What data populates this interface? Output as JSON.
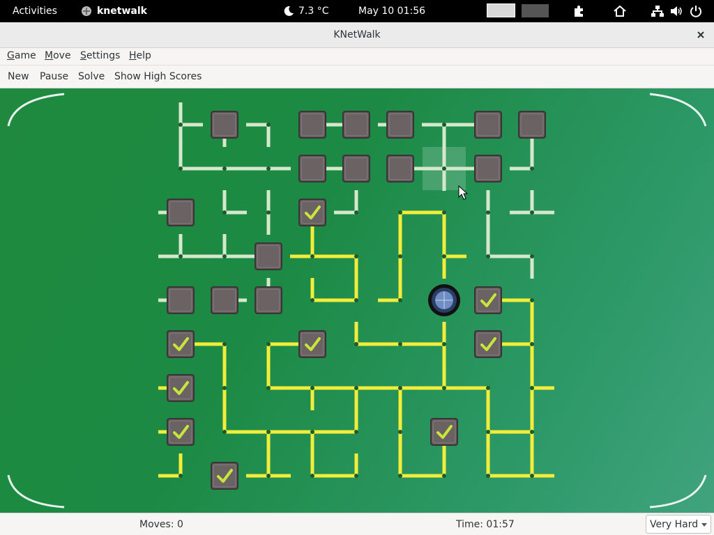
{
  "topbar": {
    "activities": "Activities",
    "app_name": "knetwalk",
    "weather": "7.3 °C",
    "clock": "May 10  01:56",
    "icons": [
      "weather-night-icon",
      "extensions-icon",
      "home-icon",
      "network-icon",
      "volume-icon",
      "power-icon"
    ]
  },
  "window": {
    "title": "KNetWalk"
  },
  "menu": {
    "game": "Game",
    "move": "Move",
    "settings": "Settings",
    "help": "Help"
  },
  "toolbar": {
    "new": "New",
    "pause": "Pause",
    "solve": "Solve",
    "high_scores": "Show High Scores"
  },
  "status": {
    "moves": "Moves: 0",
    "time": "Time: 01:57",
    "difficulty": "Very Hard"
  },
  "board": {
    "columns": 9,
    "rows": 9,
    "colors": {
      "connected_cable": "#f2ec3a",
      "disconnected_cable": "#d6e8cc",
      "server": "#2a3f66"
    },
    "server_cell": [
      6,
      4
    ],
    "computers": [
      {
        "c": 1,
        "r": 0,
        "on": false
      },
      {
        "c": 3,
        "r": 0,
        "on": false
      },
      {
        "c": 4,
        "r": 0,
        "on": false
      },
      {
        "c": 5,
        "r": 0,
        "on": false
      },
      {
        "c": 7,
        "r": 0,
        "on": false
      },
      {
        "c": 8,
        "r": 0,
        "on": false
      },
      {
        "c": 3,
        "r": 1,
        "on": false
      },
      {
        "c": 4,
        "r": 1,
        "on": false
      },
      {
        "c": 5,
        "r": 1,
        "on": false
      },
      {
        "c": 7,
        "r": 1,
        "on": false
      },
      {
        "c": 0,
        "r": 2,
        "on": false
      },
      {
        "c": 3,
        "r": 2,
        "on": true
      },
      {
        "c": 2,
        "r": 3,
        "on": false
      },
      {
        "c": 0,
        "r": 4,
        "on": false
      },
      {
        "c": 1,
        "r": 4,
        "on": false
      },
      {
        "c": 2,
        "r": 4,
        "on": false
      },
      {
        "c": 7,
        "r": 4,
        "on": true
      },
      {
        "c": 0,
        "r": 5,
        "on": true
      },
      {
        "c": 3,
        "r": 5,
        "on": true
      },
      {
        "c": 7,
        "r": 5,
        "on": true
      },
      {
        "c": 0,
        "r": 6,
        "on": true
      },
      {
        "c": 0,
        "r": 7,
        "on": true
      },
      {
        "c": 6,
        "r": 7,
        "on": true
      },
      {
        "c": 1,
        "r": 8,
        "on": true
      }
    ],
    "cables": [
      {
        "c": 0,
        "r": 0,
        "d": "NES",
        "on": false
      },
      {
        "c": 1,
        "r": 0,
        "d": "S",
        "on": false
      },
      {
        "c": 2,
        "r": 0,
        "d": "WS",
        "on": false
      },
      {
        "c": 3,
        "r": 0,
        "d": "E",
        "on": false
      },
      {
        "c": 4,
        "r": 0,
        "d": "W",
        "on": false
      },
      {
        "c": 5,
        "r": 0,
        "d": "W",
        "on": false
      },
      {
        "c": 6,
        "r": 0,
        "d": "WES",
        "on": false
      },
      {
        "c": 7,
        "r": 0,
        "d": "W",
        "on": false
      },
      {
        "c": 8,
        "r": 0,
        "d": "S",
        "on": false
      },
      {
        "c": 0,
        "r": 1,
        "d": "NE",
        "on": false
      },
      {
        "c": 1,
        "r": 1,
        "d": "EW",
        "on": false
      },
      {
        "c": 2,
        "r": 1,
        "d": "EW",
        "on": false
      },
      {
        "c": 3,
        "r": 1,
        "d": "E",
        "on": false
      },
      {
        "c": 4,
        "r": 1,
        "d": "W",
        "on": false
      },
      {
        "c": 5,
        "r": 1,
        "d": "E",
        "on": false
      },
      {
        "c": 6,
        "r": 1,
        "d": "NWES",
        "on": false
      },
      {
        "c": 7,
        "r": 1,
        "d": "W",
        "on": false
      },
      {
        "c": 8,
        "r": 1,
        "d": "NW",
        "on": false
      },
      {
        "c": 0,
        "r": 2,
        "d": "W",
        "on": false
      },
      {
        "c": 1,
        "r": 2,
        "d": "NE",
        "on": false
      },
      {
        "c": 2,
        "r": 2,
        "d": "NS",
        "on": false
      },
      {
        "c": 3,
        "r": 2,
        "d": "S",
        "on": true
      },
      {
        "c": 4,
        "r": 2,
        "d": "NW",
        "on": false
      },
      {
        "c": 5,
        "r": 2,
        "d": "ES",
        "on": true
      },
      {
        "c": 6,
        "r": 2,
        "d": "WS",
        "on": true
      },
      {
        "c": 7,
        "r": 2,
        "d": "NS",
        "on": false
      },
      {
        "c": 8,
        "r": 2,
        "d": "NWE",
        "on": false
      },
      {
        "c": 0,
        "r": 3,
        "d": "NWE",
        "on": false
      },
      {
        "c": 1,
        "r": 3,
        "d": "NWE",
        "on": false
      },
      {
        "c": 2,
        "r": 3,
        "d": "W",
        "on": false
      },
      {
        "c": 3,
        "r": 3,
        "d": "NWE",
        "on": true
      },
      {
        "c": 4,
        "r": 3,
        "d": "WS",
        "on": true
      },
      {
        "c": 5,
        "r": 3,
        "d": "NS",
        "on": true
      },
      {
        "c": 6,
        "r": 3,
        "d": "NES",
        "on": true
      },
      {
        "c": 7,
        "r": 3,
        "d": "NE",
        "on": false
      },
      {
        "c": 8,
        "r": 3,
        "d": "WS",
        "on": false
      },
      {
        "c": 0,
        "r": 4,
        "d": "W",
        "on": false
      },
      {
        "c": 1,
        "r": 4,
        "d": "E",
        "on": false
      },
      {
        "c": 2,
        "r": 4,
        "d": "N",
        "on": false
      },
      {
        "c": 3,
        "r": 4,
        "d": "NE",
        "on": true
      },
      {
        "c": 4,
        "r": 4,
        "d": "NW",
        "on": true
      },
      {
        "c": 5,
        "r": 4,
        "d": "NW",
        "on": true
      },
      {
        "c": 7,
        "r": 4,
        "d": "E",
        "on": true
      },
      {
        "c": 8,
        "r": 4,
        "d": "WS",
        "on": true
      },
      {
        "c": 0,
        "r": 5,
        "d": "E",
        "on": true
      },
      {
        "c": 1,
        "r": 5,
        "d": "WS",
        "on": true
      },
      {
        "c": 2,
        "r": 5,
        "d": "ES",
        "on": true
      },
      {
        "c": 3,
        "r": 5,
        "d": "W",
        "on": true
      },
      {
        "c": 4,
        "r": 5,
        "d": "NE",
        "on": true
      },
      {
        "c": 5,
        "r": 5,
        "d": "WE",
        "on": true
      },
      {
        "c": 6,
        "r": 5,
        "d": "NWS",
        "on": true
      },
      {
        "c": 7,
        "r": 5,
        "d": "E",
        "on": true
      },
      {
        "c": 8,
        "r": 5,
        "d": "NWS",
        "on": true
      },
      {
        "c": 0,
        "r": 6,
        "d": "W",
        "on": true
      },
      {
        "c": 1,
        "r": 6,
        "d": "NS",
        "on": true
      },
      {
        "c": 2,
        "r": 6,
        "d": "NE",
        "on": true
      },
      {
        "c": 3,
        "r": 6,
        "d": "WES",
        "on": true
      },
      {
        "c": 4,
        "r": 6,
        "d": "WES",
        "on": true
      },
      {
        "c": 5,
        "r": 6,
        "d": "WES",
        "on": true
      },
      {
        "c": 6,
        "r": 6,
        "d": "NWE",
        "on": true
      },
      {
        "c": 7,
        "r": 6,
        "d": "WS",
        "on": true
      },
      {
        "c": 8,
        "r": 6,
        "d": "NSE",
        "on": true
      },
      {
        "c": 0,
        "r": 7,
        "d": "W",
        "on": true
      },
      {
        "c": 1,
        "r": 7,
        "d": "NE",
        "on": true
      },
      {
        "c": 2,
        "r": 7,
        "d": "WES",
        "on": true
      },
      {
        "c": 3,
        "r": 7,
        "d": "WES",
        "on": true
      },
      {
        "c": 4,
        "r": 7,
        "d": "NW",
        "on": true
      },
      {
        "c": 5,
        "r": 7,
        "d": "NS",
        "on": true
      },
      {
        "c": 6,
        "r": 7,
        "d": "S",
        "on": true
      },
      {
        "c": 7,
        "r": 7,
        "d": "NSE",
        "on": true
      },
      {
        "c": 8,
        "r": 7,
        "d": "NSW",
        "on": true
      },
      {
        "c": 0,
        "r": 8,
        "d": "WN",
        "on": true
      },
      {
        "c": 2,
        "r": 8,
        "d": "NWE",
        "on": true
      },
      {
        "c": 3,
        "r": 8,
        "d": "NE",
        "on": true
      },
      {
        "c": 4,
        "r": 8,
        "d": "NW",
        "on": true
      },
      {
        "c": 5,
        "r": 8,
        "d": "NE",
        "on": true
      },
      {
        "c": 6,
        "r": 8,
        "d": "NW",
        "on": true
      },
      {
        "c": 7,
        "r": 8,
        "d": "NE",
        "on": true
      },
      {
        "c": 8,
        "r": 8,
        "d": "NWE",
        "on": true
      }
    ]
  }
}
